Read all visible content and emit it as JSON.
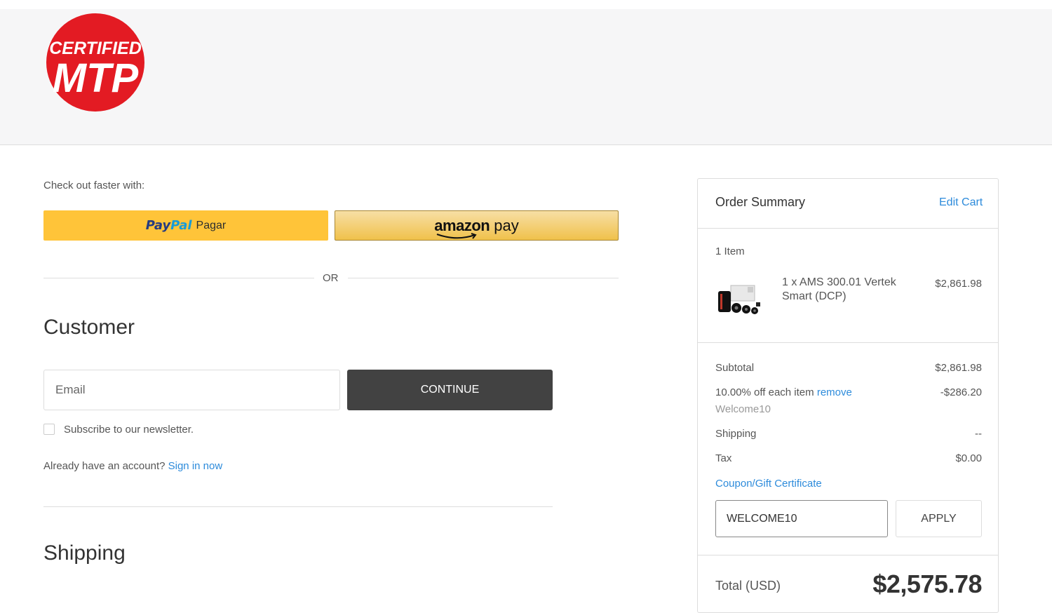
{
  "brand": {
    "logo_line1": "CERTIFIED",
    "logo_line2": "MTP",
    "logo_color": "#e31b23"
  },
  "express": {
    "heading": "Check out faster with:",
    "paypal": {
      "brand_a": "Pay",
      "brand_b": "Pal",
      "label": "Pagar",
      "color": "#ffc439"
    },
    "amazon": {
      "brand": "amazon",
      "label": "pay"
    },
    "or": "OR"
  },
  "customer": {
    "heading": "Customer",
    "email_placeholder": "Email",
    "continue_label": "CONTINUE",
    "newsletter_label": "Subscribe to our newsletter.",
    "account_prompt": "Already have an account?",
    "sign_in_label": "Sign in now"
  },
  "shipping": {
    "heading": "Shipping"
  },
  "summary": {
    "title": "Order Summary",
    "edit_cart": "Edit Cart",
    "item_count": "1 Item",
    "items": [
      {
        "name": "1 x AMS 300.01 Vertek Smart (DCP)",
        "price": "$2,861.98"
      }
    ],
    "subtotal_label": "Subtotal",
    "subtotal_value": "$2,861.98",
    "discount_label": "10.00% off each item",
    "discount_remove": "remove",
    "discount_value": "-$286.20",
    "discount_code": "Welcome10",
    "shipping_label": "Shipping",
    "shipping_value": "--",
    "tax_label": "Tax",
    "tax_value": "$0.00",
    "coupon_link": "Coupon/Gift Certificate",
    "coupon_value": "WELCOME10",
    "apply_label": "APPLY",
    "total_label": "Total (USD)",
    "total_value": "$2,575.78"
  },
  "colors": {
    "link": "#2d8bdb",
    "dark_button": "#424242"
  }
}
